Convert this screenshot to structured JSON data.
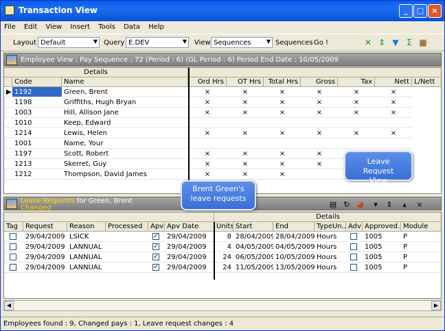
{
  "window": {
    "title": "Transaction View",
    "minimize": "_",
    "maximize": "□",
    "close": "×"
  },
  "menu": [
    "File",
    "Edit",
    "View",
    "Insert",
    "Tools",
    "Data",
    "Help"
  ],
  "toolbar": {
    "layout_label": "Layout",
    "layout_value": "Default",
    "query_label": "Query",
    "query_value": "E.DEV",
    "view_label": "View",
    "view_value": "Sequences",
    "sequences_label": "Sequences",
    "go_label": "Go !"
  },
  "employee_section": {
    "header": "Employee View : Pay Sequence : 72 (Period : 6) (GL Period : 6) Period End Date : 10/05/2009",
    "group_header": "Details",
    "columns": [
      "Code",
      "Name",
      "Ord Hrs",
      "OT Hrs",
      "Total Hrs",
      "Gross",
      "Tax",
      "Nett",
      "L/Nett"
    ],
    "rows": [
      {
        "code": "1192",
        "name": "Green, Brent",
        "m": [
          "×",
          "×",
          "×",
          "×",
          "×",
          "×"
        ]
      },
      {
        "code": "1198",
        "name": "Griffiths, Hugh Bryan",
        "m": [
          "×",
          "×",
          "×",
          "×",
          "×",
          "×"
        ]
      },
      {
        "code": "1003",
        "name": "Hill, Allison Jane",
        "m": [
          "×",
          "×",
          "×",
          "×",
          "×",
          "×"
        ]
      },
      {
        "code": "1010",
        "name": "Keep, Edward",
        "m": [
          "",
          "",
          "",
          "",
          "",
          ""
        ]
      },
      {
        "code": "1214",
        "name": "Lewis, Helen",
        "m": [
          "×",
          "×",
          "×",
          "×",
          "×",
          "×"
        ]
      },
      {
        "code": "1001",
        "name": "Name, Your",
        "m": [
          "",
          "",
          "",
          "",
          "",
          ""
        ]
      },
      {
        "code": "1197",
        "name": "Scott, Robert",
        "m": [
          "×",
          "×",
          "×",
          "×",
          "",
          ""
        ]
      },
      {
        "code": "1213",
        "name": "Skerret, Guy",
        "m": [
          "×",
          "×",
          "×",
          "×",
          "",
          ""
        ]
      },
      {
        "code": "1212",
        "name": "Thompson, David James",
        "m": [
          "×",
          "×",
          "×",
          "",
          "",
          ""
        ]
      }
    ]
  },
  "leave_section": {
    "header_title": "Leave Requests",
    "header_for": "for Green, Brent",
    "header_status": "Changed",
    "group_header": "Details",
    "columns": [
      "Tag",
      "Request",
      "Reason",
      "Processed",
      "Apv",
      "Apv Date",
      "Units",
      "Start",
      "End",
      "TypeUn...",
      "Adv",
      "Approved...",
      "Module"
    ],
    "rows": [
      {
        "request": "29/04/2009 *",
        "reason": "LSICK",
        "apv_date": "29/04/2009",
        "units": "8",
        "start": "28/04/2009",
        "end": "28/04/2009",
        "type": "Hours",
        "approved": "1005",
        "module": "P"
      },
      {
        "request": "29/04/2009 *",
        "reason": "LANNUAL",
        "apv_date": "29/04/2009",
        "units": "4",
        "start": "04/05/2009",
        "end": "04/05/2009",
        "type": "Hours",
        "approved": "1005",
        "module": "P"
      },
      {
        "request": "29/04/2009 *",
        "reason": "LANNUAL",
        "apv_date": "29/04/2009",
        "units": "24",
        "start": "06/05/2009",
        "end": "10/05/2009",
        "type": "Hours",
        "approved": "1005",
        "module": "P"
      },
      {
        "request": "29/04/2009 *",
        "reason": "LANNUAL",
        "apv_date": "29/04/2009",
        "units": "24",
        "start": "11/05/2009",
        "end": "13/05/2009",
        "type": "Hours",
        "approved": "1005",
        "module": "P"
      }
    ]
  },
  "callouts": {
    "leave_requests": "Brent Green's leave requests",
    "leave_view": "Leave Request View"
  },
  "status": "Employees found : 9, Changed pays : 1, Leave request changes : 4"
}
